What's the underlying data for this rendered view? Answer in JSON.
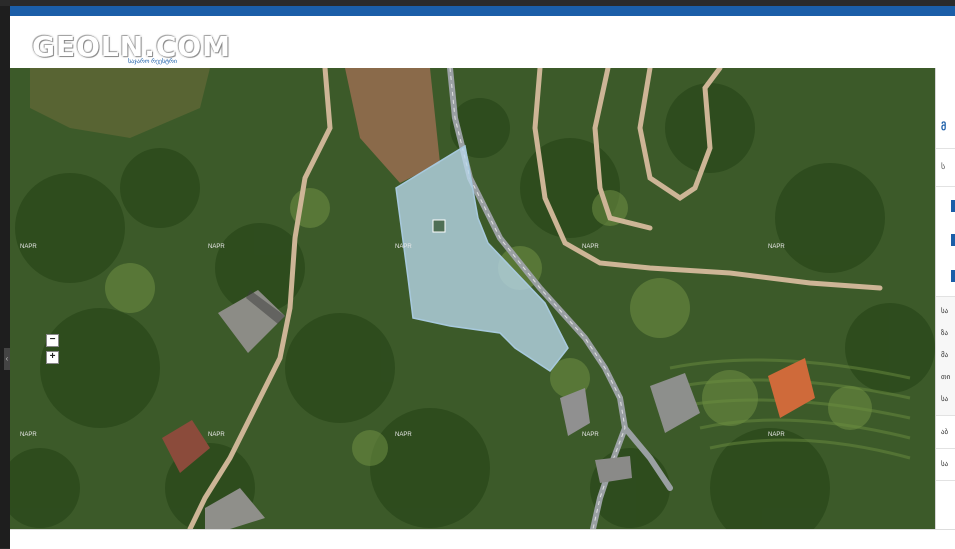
{
  "header": {
    "logo_text": "GEOLN.COM",
    "logo_subtitle": "საჯარო რეესტრი"
  },
  "map": {
    "watermark": "NAPR",
    "zoom_out_label": "−",
    "zoom_in_label": "+",
    "parcel_color": "#b8d7ea"
  },
  "sidebar": {
    "items": [
      {
        "label": "მ"
      },
      {
        "label": "ს"
      },
      {
        "label": "ა"
      },
      {
        "label": "ს"
      }
    ],
    "texts": [
      "სა",
      "ზა",
      "მა",
      "თი",
      "სა",
      "აბ",
      "სა"
    ]
  },
  "colors": {
    "accent": "#1b5ea8"
  }
}
